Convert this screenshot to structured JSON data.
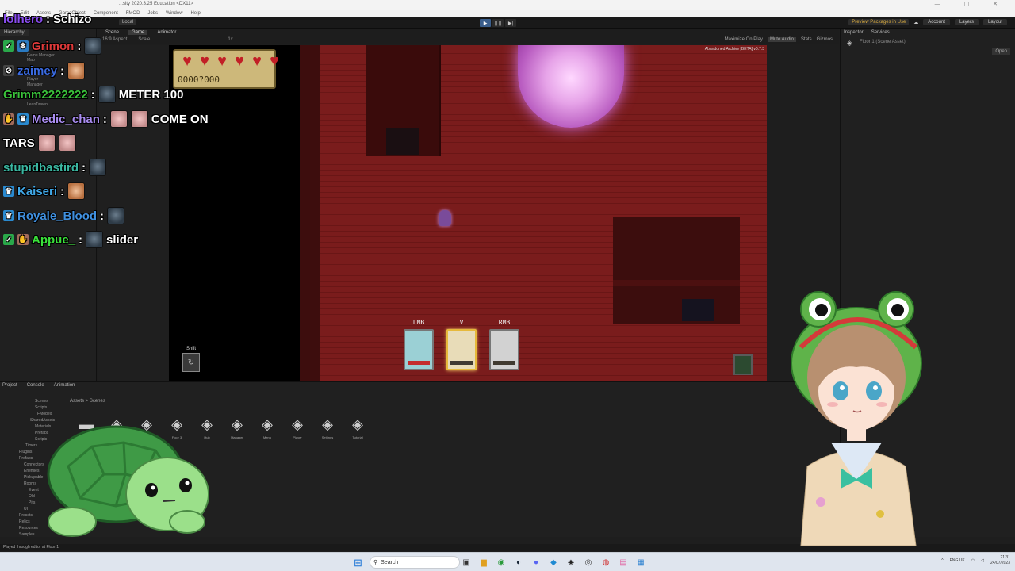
{
  "window": {
    "title": "...sity 2020.3.25 Education <DX11>",
    "menu": [
      "File",
      "Edit",
      "Assets",
      "GameObject",
      "Component",
      "FMOD",
      "Jobs",
      "Window",
      "Help"
    ]
  },
  "toolbar": {
    "local_label": "Local",
    "preview_label": "Preview Packages in Use",
    "account_label": "Account",
    "layers_label": "Layers",
    "layout_label": "Layout"
  },
  "hierarchy": {
    "tab": "Hierarchy",
    "items": [
      "Game Manager",
      "Map",
      "Player",
      "Manager",
      "LeanTween"
    ]
  },
  "game_view": {
    "tabs": [
      "Scene",
      "Game",
      "Animator"
    ],
    "display": "16:9 Aspect",
    "scale_label": "Scale",
    "scale_value": "1x",
    "right_buttons": [
      "Maximize On Play",
      "Mute Audio",
      "Stats",
      "Gizmos"
    ],
    "version": "Abandoned Archive [BETA] v0.7.3",
    "coins": "0000?000",
    "hearts": 6,
    "shift_label": "Shift",
    "abilities": [
      {
        "key": "LMB",
        "selected": false,
        "style": "blue"
      },
      {
        "key": "V",
        "selected": true,
        "style": "plain"
      },
      {
        "key": "RMB",
        "selected": false,
        "style": "plain"
      }
    ]
  },
  "inspector": {
    "tabs": [
      "Inspector",
      "Services"
    ],
    "asset": "Floor 1 (Scene Asset)",
    "open_label": "Open"
  },
  "project": {
    "tabs": [
      "Project",
      "Console",
      "Animation"
    ],
    "tree": [
      "Scenes",
      "Scripts",
      "TFModels",
      "SharedAssets",
      "Materials",
      "Prefabs",
      "Scripts",
      "Timers",
      "Plugins",
      "Prefabs",
      "Connectors",
      "Enemies",
      "Pickupable",
      "Rooms",
      "Event",
      "Old",
      "Pits",
      "UI",
      "Presets",
      "Relics",
      "Resources",
      "Samples",
      "Scenes"
    ],
    "breadcrumb": "Assets > Scenes",
    "assets": [
      "",
      "",
      "",
      "Floor 3",
      "Hub",
      "Manager",
      "Menu",
      "Player",
      "Settings",
      "Tutorial"
    ]
  },
  "status_bar": "Played through editor at Floor 1",
  "taskbar": {
    "search_placeholder": "Search",
    "lang": "ENG UK",
    "time": "21:31",
    "date": "24/07/2023"
  },
  "chat": [
    {
      "user": "lolhero",
      "color": "#8a4df0",
      "message": "Schizo",
      "badges": [],
      "emotes": []
    },
    {
      "user": "Grimon",
      "color": "#e03a3a",
      "message": "",
      "badges": [
        "check",
        "snow"
      ],
      "emotes": [
        "face"
      ]
    },
    {
      "user": "zaimey",
      "color": "#3a6ae0",
      "message": "",
      "badges": [
        "mute"
      ],
      "emotes": [
        "cat"
      ]
    },
    {
      "user": "Grimm2222222",
      "color": "#3ac23a",
      "message": "METER 100",
      "badges": [],
      "emotes": [
        "face"
      ]
    },
    {
      "user": "Medic_chan",
      "color": "#a98cf0",
      "message": "COME ON",
      "badges": [
        "heart",
        "crown"
      ],
      "emotes": [
        "pig",
        "pig"
      ]
    },
    {
      "user": "",
      "color": "#ffffff",
      "message": "TARS",
      "badges": [],
      "emotes": [
        "pig",
        "pig"
      ]
    },
    {
      "user": "stupidbastird",
      "color": "#3ab6a0",
      "message": "",
      "badges": [],
      "emotes": [
        "face"
      ]
    },
    {
      "user": "Kaiseri",
      "color": "#40a8e8",
      "message": "",
      "badges": [
        "crown"
      ],
      "emotes": [
        "cat"
      ]
    },
    {
      "user": "Royale_Blood",
      "color": "#4090e0",
      "message": "",
      "badges": [
        "crown"
      ],
      "emotes": [
        "face"
      ]
    },
    {
      "user": "Appue_",
      "color": "#3ae03a",
      "message": "slider",
      "badges": [
        "check",
        "hand"
      ],
      "emotes": [
        "face"
      ]
    }
  ]
}
